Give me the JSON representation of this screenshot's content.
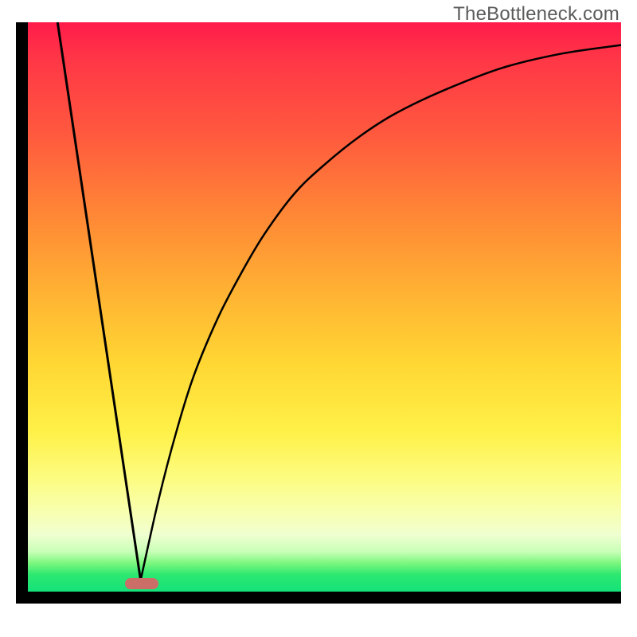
{
  "watermark": "TheBottleneck.com",
  "colors": {
    "frame": "#000000",
    "marker": "#cb6e68",
    "curve": "#000000",
    "gradient_top": "#ff1b4b",
    "gradient_bottom": "#14e27a"
  },
  "chart_data": {
    "type": "line",
    "title": "",
    "xlabel": "",
    "ylabel": "",
    "xlim": [
      0,
      100
    ],
    "ylim": [
      0,
      100
    ],
    "annotations": [
      {
        "kind": "marker",
        "x": 19,
        "y": 2,
        "color": "#cb6e68"
      }
    ],
    "series": [
      {
        "name": "left-descent",
        "x": [
          5,
          19
        ],
        "y": [
          100,
          2
        ]
      },
      {
        "name": "right-curve",
        "x": [
          19,
          22,
          25,
          28,
          32,
          36,
          40,
          45,
          50,
          56,
          62,
          70,
          80,
          90,
          100
        ],
        "y": [
          2,
          16,
          28,
          38,
          48,
          56,
          63,
          70,
          75,
          80,
          84,
          88,
          92,
          94.5,
          96
        ]
      }
    ]
  }
}
